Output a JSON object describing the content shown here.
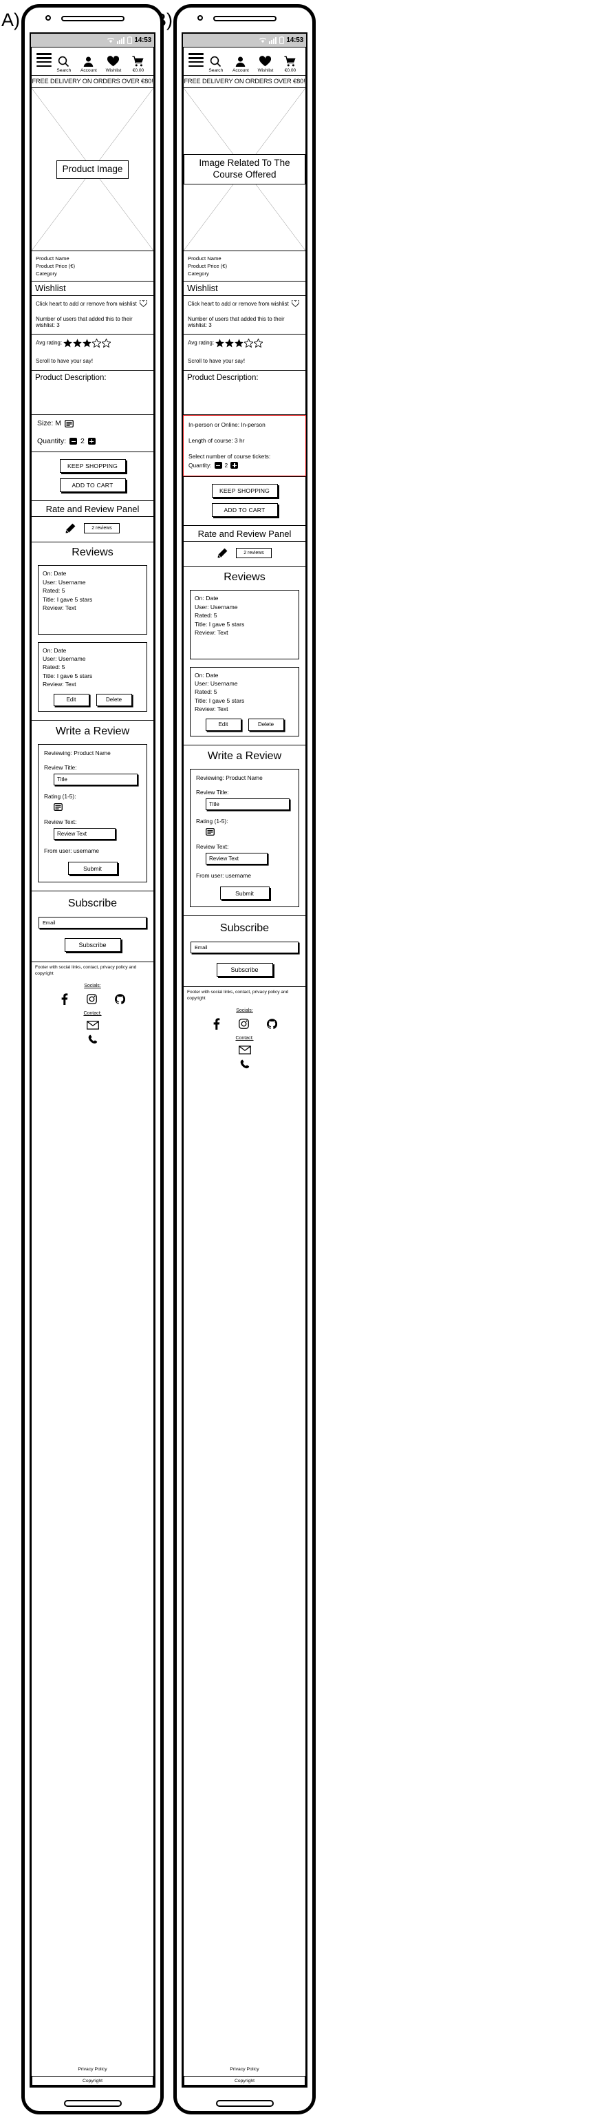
{
  "panels": {
    "a_label": "A)",
    "b_label": "B)"
  },
  "status_bar": {
    "time": "14:53"
  },
  "nav": {
    "menu_icon": "hamburger-menu-icon",
    "items": [
      {
        "label": "Search",
        "icon": "search-icon"
      },
      {
        "label": "Account",
        "icon": "account-icon"
      },
      {
        "label": "Wishlist",
        "icon": "heart-icon"
      },
      {
        "label": "€0.00",
        "icon": "cart-icon"
      }
    ]
  },
  "promo": {
    "text": "FREE DELIVERY ON ORDERS OVER €80!"
  },
  "hero_a": {
    "label": "Product Image"
  },
  "hero_b": {
    "label": "Image Related To The Course Offered"
  },
  "product_info": {
    "name": "Product Name",
    "price": "Product Price (€)",
    "category": "Category"
  },
  "wishlist": {
    "title": "Wishlist",
    "hint": "Click heart to add or remove from wishlist",
    "count_text": "Number of users that added this to their wishlist: 3",
    "heart_icon": "heart-outline-icon"
  },
  "rating": {
    "label": "Avg rating:",
    "filled_stars": 3,
    "total_stars": 5,
    "scroll_text": "Scroll to have your say!"
  },
  "description": {
    "title": "Product Description:"
  },
  "options_a": {
    "size_label": "Size: M",
    "size_icon": "select-dropdown-icon",
    "quantity_label": "Quantity:",
    "quantity_value": "2",
    "minus_icon": "minus-icon",
    "plus_icon": "plus-icon"
  },
  "course_box": {
    "mode": "In-person or Online: In-person",
    "length": "Length of course: 3 hr",
    "tickets_label": "Select number of course tickets:",
    "quantity_label": "Quantity:",
    "quantity_value": "2",
    "border_color": "#e41f1f"
  },
  "actions": {
    "keep_shopping": "KEEP SHOPPING",
    "add_to_cart": "ADD TO CART"
  },
  "review_panel": {
    "title": "Rate and Review Panel",
    "pencil_icon": "pencil-icon",
    "count_label": "2 reviews"
  },
  "reviews": {
    "heading": "Reviews",
    "items": [
      {
        "date": "On: Date",
        "user": "User: Username",
        "rated": "Rated: 5",
        "title": "Title: I gave 5 stars",
        "text": "Review: Text",
        "has_actions": false
      },
      {
        "date": "On: Date",
        "user": "User: Username",
        "rated": "Rated: 5",
        "title": "Title: I gave 5 stars",
        "text": "Review: Text",
        "has_actions": true,
        "edit_label": "Edit",
        "delete_label": "Delete"
      }
    ]
  },
  "write_review": {
    "heading": "Write a Review",
    "reviewing": "Reviewing: Product Name",
    "title_label": "Review Title:",
    "title_value": "Title",
    "rating_label": "Rating (1-5):",
    "rating_icon": "select-dropdown-icon",
    "text_label": "Review Text:",
    "text_value": "Review Text",
    "from_user": "From user: username",
    "submit_label": "Submit"
  },
  "subscribe": {
    "heading": "Subscribe",
    "email_placeholder": "Email",
    "button_label": "Subscribe"
  },
  "footer": {
    "note": "Footer with social links, contact, privacy policy and copyright",
    "socials_heading": "Socials:",
    "socials": [
      {
        "name": "facebook-icon"
      },
      {
        "name": "instagram-icon"
      },
      {
        "name": "github-icon"
      }
    ],
    "contact_heading": "Contact:",
    "contacts": [
      {
        "name": "email-icon"
      },
      {
        "name": "phone-icon"
      }
    ],
    "privacy": "Privacy Policy",
    "copyright": "Copyright"
  }
}
